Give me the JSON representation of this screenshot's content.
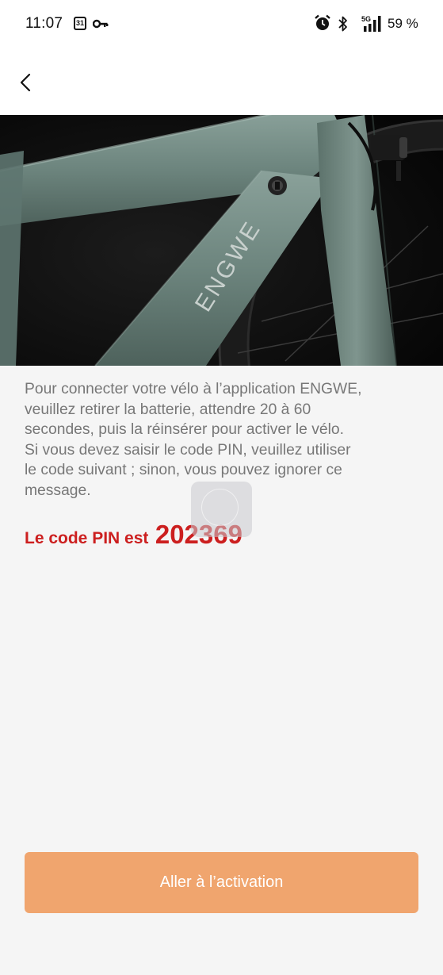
{
  "status_bar": {
    "time": "11:07",
    "calendar_day": "31",
    "network": "5G",
    "battery": "59 %"
  },
  "hero": {
    "brand_text": "ENGWE"
  },
  "message": {
    "text": "Pour connecter votre vélo à l’application ENGWE, veuillez retirer la batterie, attendre 20 à 60 secondes, puis la réinsérer pour activer le vélo. Si vous devez saisir le code PIN, veuillez utiliser le code suivant ; sinon, vous pouvez ignorer ce message.",
    "lines": [
      "Pour connecter votre vélo à l’application ENGWE,",
      "veuillez retirer la batterie, attendre 20 à 60",
      "secondes, puis la réinsérer pour activer le vélo.",
      "Si vous devez saisir le code PIN, veuillez utiliser",
      "le code suivant ; sinon, vous pouvez ignorer ce",
      "message."
    ]
  },
  "pin": {
    "label": "Le code PIN est",
    "code": "202369"
  },
  "activate_button": {
    "label": "Aller à l’activation"
  },
  "colors": {
    "accent_button": "#f0a56e",
    "pin_red": "#cc1f1f",
    "body_text": "#777777",
    "background": "#f5f5f5"
  }
}
